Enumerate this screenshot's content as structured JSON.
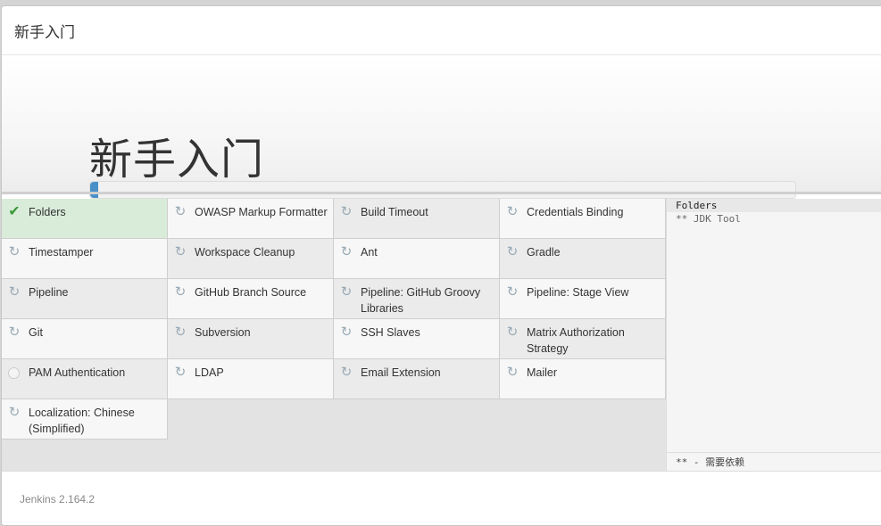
{
  "header": {
    "title": "新手入门"
  },
  "hero": {
    "title": "新手入门",
    "progress": 0.012
  },
  "plugins": [
    {
      "label": "Folders",
      "status": "done"
    },
    {
      "label": "OWASP Markup Formatter",
      "status": "pending"
    },
    {
      "label": "Build Timeout",
      "status": "pending"
    },
    {
      "label": "Credentials Binding",
      "status": "pending"
    },
    {
      "label": "Timestamper",
      "status": "pending"
    },
    {
      "label": "Workspace Cleanup",
      "status": "pending"
    },
    {
      "label": "Ant",
      "status": "pending"
    },
    {
      "label": "Gradle",
      "status": "pending"
    },
    {
      "label": "Pipeline",
      "status": "installing"
    },
    {
      "label": "GitHub Branch Source",
      "status": "pending"
    },
    {
      "label": "Pipeline: GitHub Groovy Libraries",
      "status": "installing"
    },
    {
      "label": "Pipeline: Stage View",
      "status": "pending"
    },
    {
      "label": "Git",
      "status": "pending"
    },
    {
      "label": "Subversion",
      "status": "pending"
    },
    {
      "label": "SSH Slaves",
      "status": "pending"
    },
    {
      "label": "Matrix Authorization Strategy",
      "status": "pending"
    },
    {
      "label": "PAM Authentication",
      "status": "not-selected"
    },
    {
      "label": "LDAP",
      "status": "pending"
    },
    {
      "label": "Email Extension",
      "status": "pending"
    },
    {
      "label": "Mailer",
      "status": "pending"
    },
    {
      "label": "Localization: Chinese (Simplified)",
      "status": "pending"
    }
  ],
  "log": {
    "line1": "Folders",
    "line2": "** JDK Tool",
    "footer": "** - 需要依赖"
  },
  "footer": {
    "version": "Jenkins 2.164.2"
  },
  "colors": {
    "progress": "#4a90c8",
    "done_bg": "#d9ecd9",
    "check": "#3a9a3a"
  }
}
